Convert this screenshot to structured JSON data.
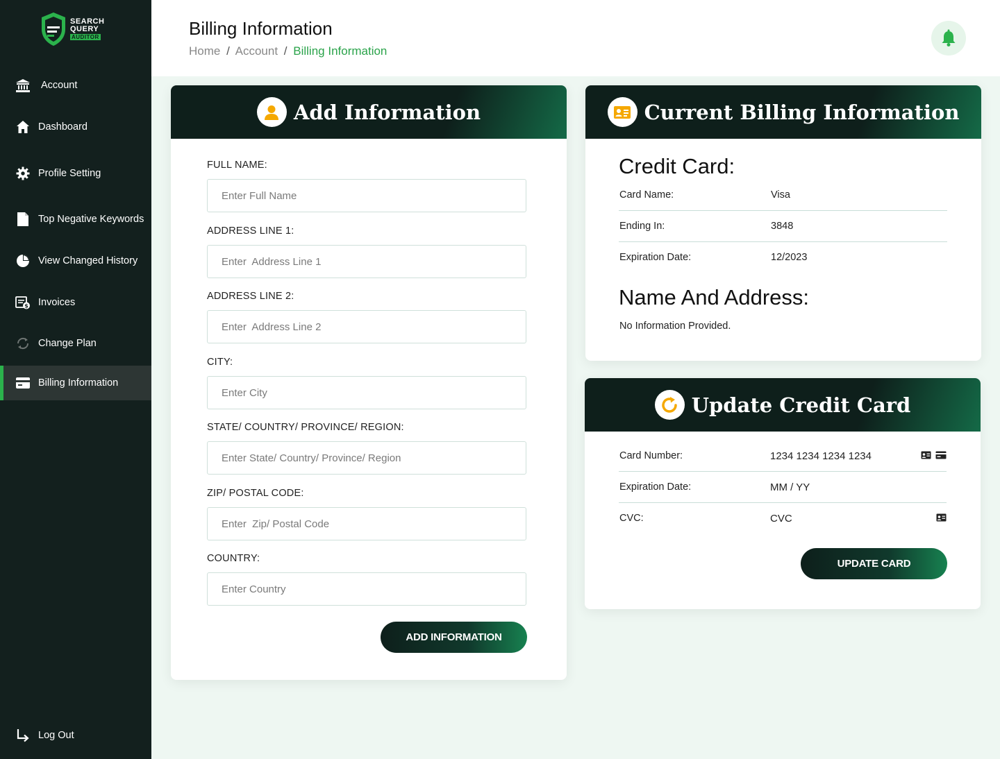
{
  "brand": {
    "line1": "SEARCH",
    "line2": "QUERY",
    "line3": "AUDITOR"
  },
  "sidebar": {
    "items": [
      {
        "label": "Account",
        "icon": "bank-icon"
      },
      {
        "label": "Dashboard",
        "icon": "home-icon"
      },
      {
        "label": "Profile Setting",
        "icon": "gear-icon"
      },
      {
        "label": "Top Negative Keywords",
        "icon": "document-icon"
      },
      {
        "label": "View Changed History",
        "icon": "pie-chart-icon"
      },
      {
        "label": "Invoices",
        "icon": "invoice-icon"
      },
      {
        "label": "Change Plan",
        "icon": "refresh-icon"
      },
      {
        "label": "Billing Information",
        "icon": "credit-card-icon",
        "active": true
      }
    ],
    "logout": "Log Out"
  },
  "header": {
    "title": "Billing Information",
    "breadcrumb": [
      "Home",
      "Account",
      "Billing Information"
    ],
    "separator": "/"
  },
  "add_info": {
    "title": "Add Information",
    "fields": [
      {
        "label": "FULL NAME:",
        "placeholder": "Enter Full Name"
      },
      {
        "label": "ADDRESS LINE 1:",
        "placeholder": "Enter  Address Line 1"
      },
      {
        "label": "ADDRESS LINE 2:",
        "placeholder": "Enter  Address Line 2"
      },
      {
        "label": "CITY:",
        "placeholder": "Enter City"
      },
      {
        "label": "STATE/ COUNTRY/ PROVINCE/ REGION:",
        "placeholder": "Enter State/ Country/ Province/ Region"
      },
      {
        "label": "ZIP/ POSTAL  CODE:",
        "placeholder": "Enter  Zip/ Postal Code"
      },
      {
        "label": "COUNTRY:",
        "placeholder": "Enter Country"
      }
    ],
    "button": "ADD INFORMATION"
  },
  "current_billing": {
    "title": "Current Billing Information",
    "credit_card_heading": "Credit Card:",
    "rows": [
      {
        "key": "Card Name:",
        "value": "Visa"
      },
      {
        "key": "Ending In:",
        "value": "3848"
      },
      {
        "key": "Expiration Date:",
        "value": "12/2023"
      }
    ],
    "address_heading": "Name And Address:",
    "address_text": "No  Information Provided."
  },
  "update_card": {
    "title": "Update Credit Card",
    "rows": [
      {
        "key": "Card Number:",
        "placeholder": "1234 1234 1234 1234"
      },
      {
        "key": "Expiration Date:",
        "placeholder": "MM / YY"
      },
      {
        "key": "CVC:",
        "placeholder": "CVC"
      }
    ],
    "button": "UPDATE CARD"
  },
  "colors": {
    "sidebar_bg": "#13201e",
    "accent_green": "#2bb24c",
    "icon_orange": "#f5a800"
  }
}
